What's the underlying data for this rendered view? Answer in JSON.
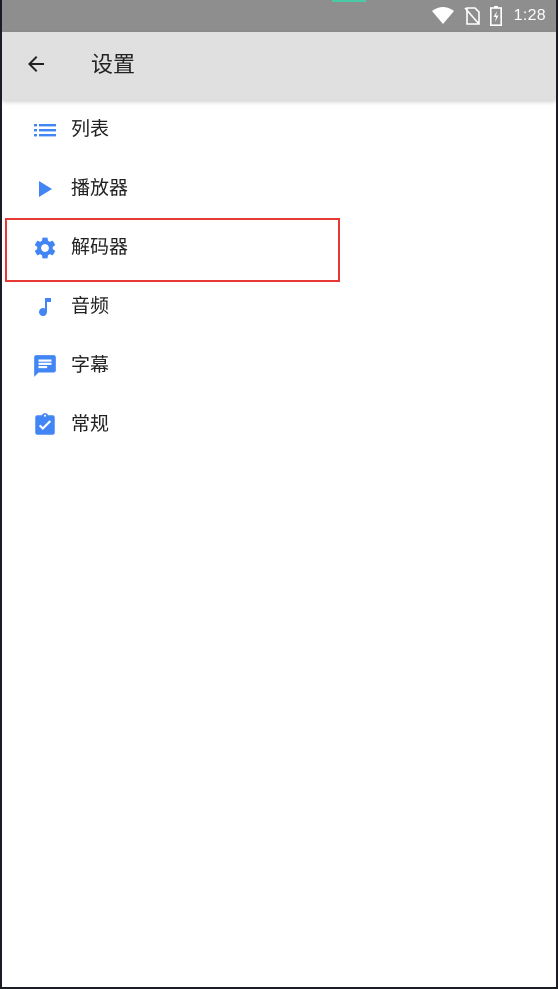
{
  "status_bar": {
    "time": "1:28",
    "icons": [
      "wifi-icon",
      "no-sim-icon",
      "battery-charging-icon"
    ],
    "accent_color": "#49c9a6"
  },
  "toolbar": {
    "back_icon": "arrow-back-icon",
    "title": "设置"
  },
  "menu": {
    "accent_color": "#4285f4",
    "highlight_color": "#e53935",
    "highlighted_item": "解码器",
    "items": [
      {
        "icon": "list-icon",
        "label": "列表"
      },
      {
        "icon": "play-icon",
        "label": "播放器"
      },
      {
        "icon": "gear-icon",
        "label": "解码器"
      },
      {
        "icon": "music-note-icon",
        "label": "音频"
      },
      {
        "icon": "subtitle-icon",
        "label": "字幕"
      },
      {
        "icon": "clipboard-check-icon",
        "label": "常规"
      }
    ]
  }
}
